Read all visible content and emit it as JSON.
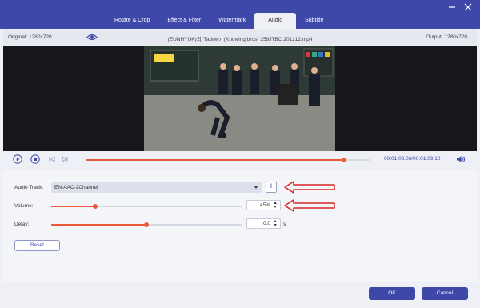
{
  "tabs": [
    {
      "label": "Rotate & Crop"
    },
    {
      "label": "Effect & Filter"
    },
    {
      "label": "Watermark"
    },
    {
      "label": "Audio",
      "active": true
    },
    {
      "label": "Subtitle"
    }
  ],
  "infobar": {
    "original": "Original: 1280x720",
    "filename": "(EUNHYUK)의 'Tadow♪' (Knowing bros) 259JTBC 201212.mp4",
    "output": "Output: 1280x720"
  },
  "player": {
    "time": "00:01:03.06/00:01:09.10",
    "progress": 0.91
  },
  "audio": {
    "track_label": "Audio Track:",
    "track_value": "EN-AAC-2Channel",
    "volume_label": "Volume:",
    "volume_value": "45%",
    "volume_level": 0.23,
    "delay_label": "Delay:",
    "delay_value": "0.0",
    "delay_unit": "s",
    "delay_level": 0.5,
    "reset_label": "Reset"
  },
  "footer": {
    "ok_label": "OK",
    "cancel_label": "Cancel"
  },
  "colors": {
    "accent": "#3e48a8",
    "slider": "#e9593c",
    "annotation": "#d82626"
  }
}
